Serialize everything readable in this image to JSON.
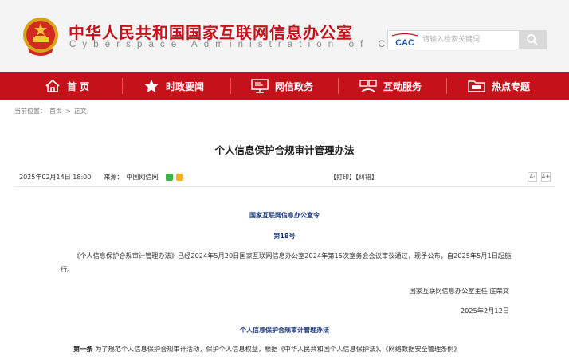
{
  "header": {
    "title": "中华人民共和国国家互联网信息办公室",
    "subtitle": "Cyberspace Administration of China",
    "search_placeholder": "请输入检索关键词",
    "logo_text": "CAC"
  },
  "nav": [
    {
      "label": "首 页",
      "icon": "home-icon"
    },
    {
      "label": "时政要闻",
      "icon": "star-icon"
    },
    {
      "label": "网信政务",
      "icon": "monitor-icon"
    },
    {
      "label": "互动服务",
      "icon": "people-icon"
    },
    {
      "label": "热点专题",
      "icon": "folder-icon"
    }
  ],
  "breadcrumb": {
    "prefix": "当前位置：",
    "home": "首页",
    "sep": ">",
    "current": "正文"
  },
  "article": {
    "title": "个人信息保护合规审计管理办法",
    "date": "2025年02月14日 18:00",
    "source_label": "来源：",
    "source": "中国网信网",
    "print": "【打印】",
    "correct": "【纠错】",
    "font_small": "A-",
    "font_large": "A+",
    "order_title": "国家互联网信息办公室令",
    "order_no": "第18号",
    "preamble": "《个人信息保护合规审计管理办法》已经2024年5月20日国家互联网信息办公室2024年第15次室务会会议审议通过，现予公布，自2025年5月1日起施行。",
    "signer": "国家互联网信息办公室主任 庄荣文",
    "sign_date": "2025年2月12日",
    "doc_title": "个人信息保护合规审计管理办法",
    "article1_label": "第一条",
    "article1_text": "为了规范个人信息保护合规审计活动，保护个人信息权益，根据《中华人民共和国个人信息保护法》、《网络数据安全管理条例》"
  },
  "colors": {
    "brand_red": "#c5121a",
    "order_blue": "#1b3a7a"
  }
}
